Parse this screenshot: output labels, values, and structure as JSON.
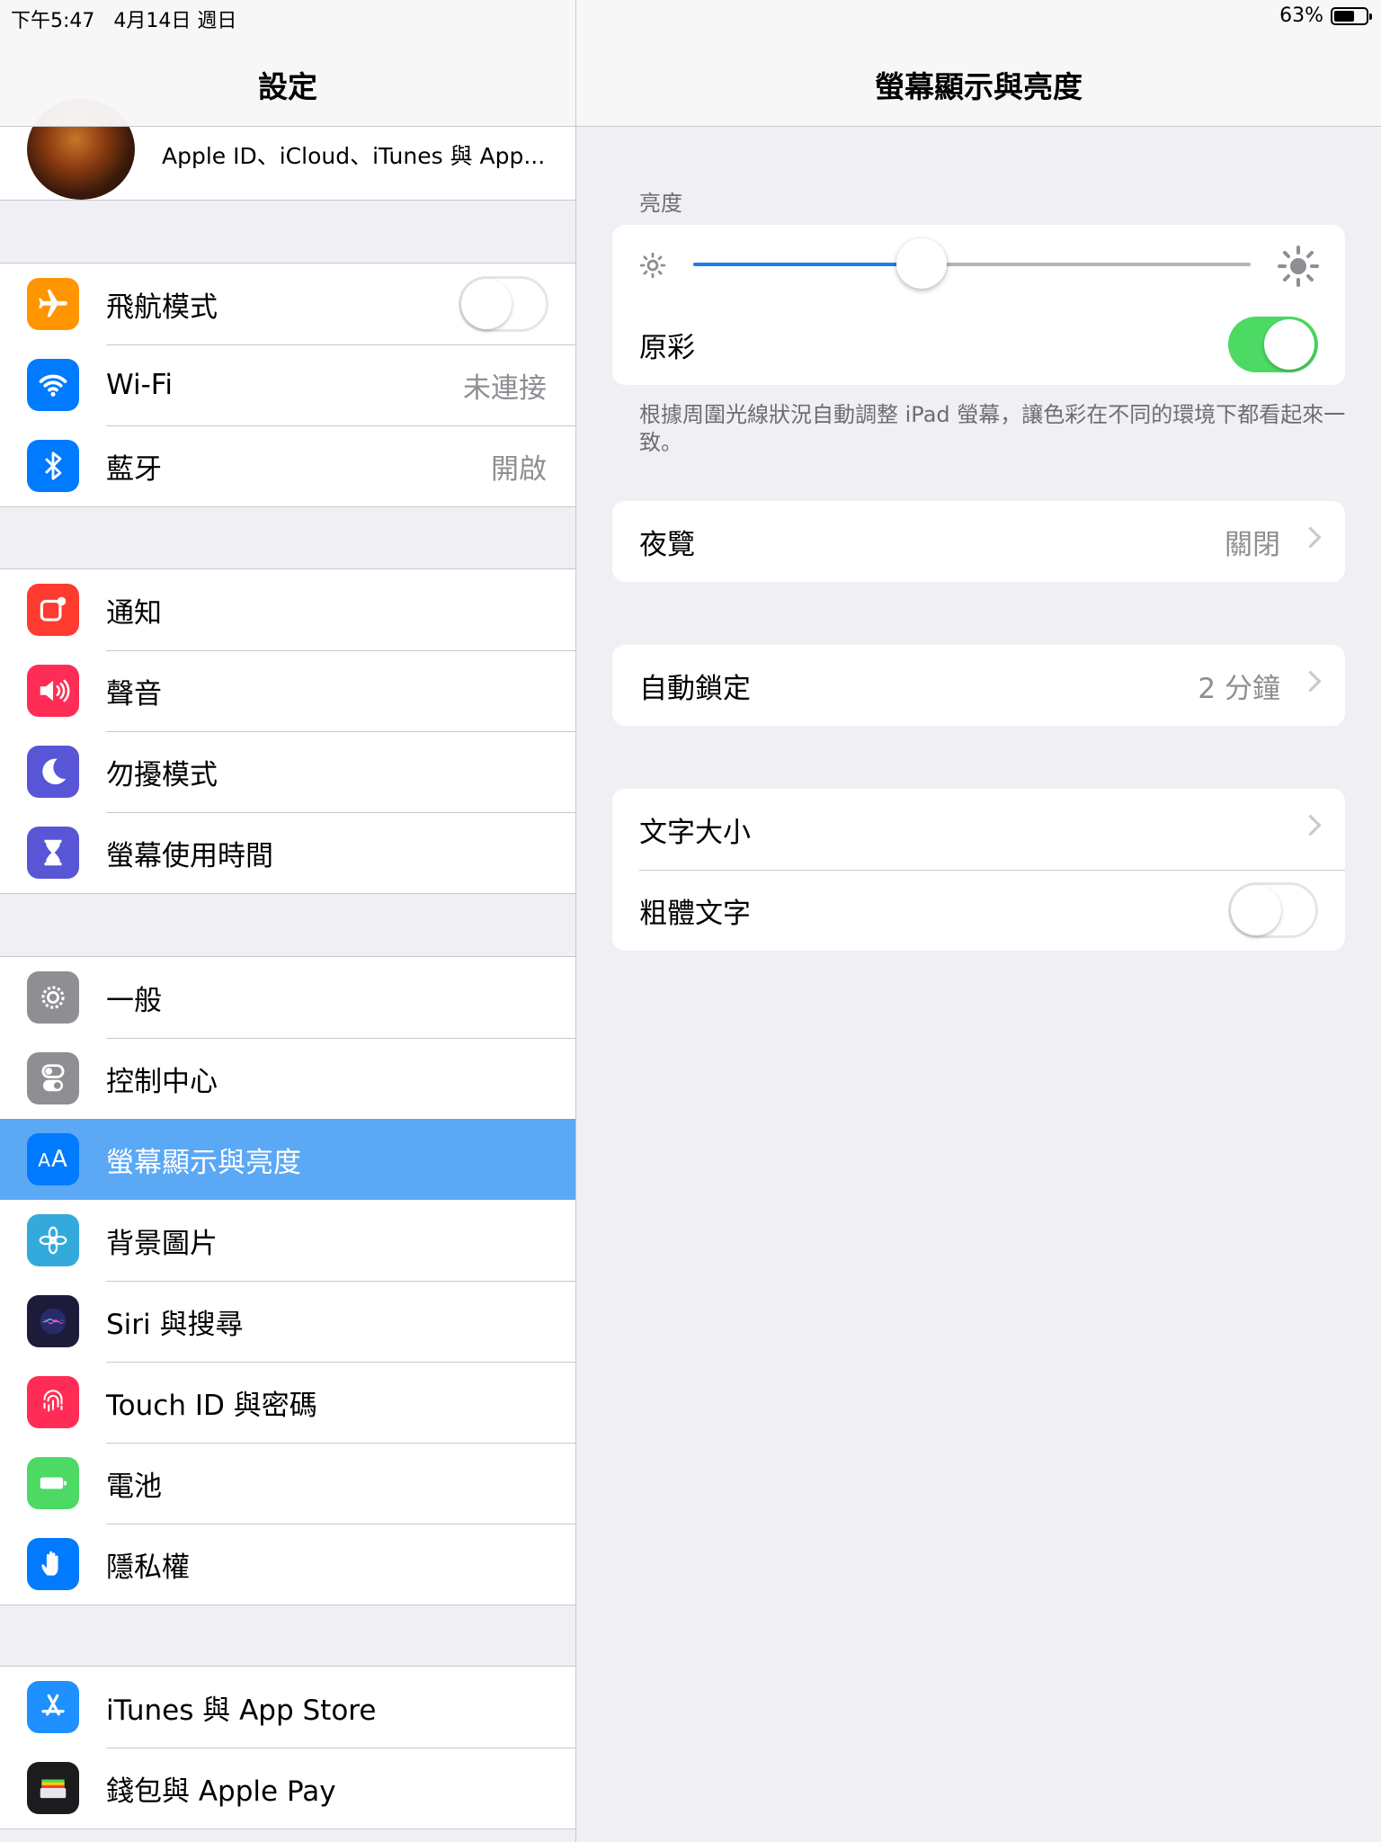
{
  "status_bar": {
    "time": "下午5:47",
    "date": "4月14日 週日",
    "battery": "63%",
    "battery_level": 0.63
  },
  "master": {
    "title": "設定",
    "profile_subtitle": "Apple ID、iCloud、iTunes 與 App...",
    "group1": [
      {
        "label": "飛航模式",
        "icon": "airplane-icon",
        "color": "#ff9500",
        "toggle": false
      },
      {
        "label": "Wi-Fi",
        "icon": "wifi-icon",
        "color": "#007aff",
        "detail": "未連接"
      },
      {
        "label": "藍牙",
        "icon": "bluetooth-icon",
        "color": "#007aff",
        "detail": "開啟"
      }
    ],
    "group2": [
      {
        "label": "通知",
        "icon": "notifications-icon",
        "color": "#ff3b30"
      },
      {
        "label": "聲音",
        "icon": "sound-icon",
        "color": "#ff2d55"
      },
      {
        "label": "勿擾模式",
        "icon": "moon-icon",
        "color": "#5856d6"
      },
      {
        "label": "螢幕使用時間",
        "icon": "hourglass-icon",
        "color": "#5856d6"
      }
    ],
    "group3": [
      {
        "label": "一般",
        "icon": "gear-icon",
        "color": "#8e8e93"
      },
      {
        "label": "控制中心",
        "icon": "toggles-icon",
        "color": "#8e8e93"
      },
      {
        "label": "螢幕顯示與亮度",
        "icon": "text-size-icon",
        "color": "#007aff",
        "selected": true,
        "icon_text": "AA"
      },
      {
        "label": "背景圖片",
        "icon": "flower-icon",
        "color": "#34aadc"
      },
      {
        "label": "Siri 與搜尋",
        "icon": "siri-icon",
        "color": "#1c1c3a"
      },
      {
        "label": "Touch ID 與密碼",
        "icon": "fingerprint-icon",
        "color": "#ff2d55"
      },
      {
        "label": "電池",
        "icon": "battery-icon",
        "color": "#4cd964"
      },
      {
        "label": "隱私權",
        "icon": "hand-icon",
        "color": "#007aff"
      }
    ],
    "group4": [
      {
        "label": "iTunes 與 App Store",
        "icon": "app-store-icon",
        "color": "#1e90ff"
      },
      {
        "label": "錢包與 Apple Pay",
        "icon": "wallet-icon",
        "color": "#1c1c1e"
      }
    ]
  },
  "detail": {
    "title": "螢幕顯示與亮度",
    "brightness_header": "亮度",
    "brightness_level": 0.41,
    "true_tone_label": "原彩",
    "true_tone_on": true,
    "true_tone_footer": "根據周圍光線狀況自動調整 iPad 螢幕，讓色彩在不同的環境下都看起來一致。",
    "night_shift_label": "夜覽",
    "night_shift_value": "關閉",
    "auto_lock_label": "自動鎖定",
    "auto_lock_value": "2 分鐘",
    "text_size_label": "文字大小",
    "bold_text_label": "粗體文字",
    "bold_text_on": false
  }
}
